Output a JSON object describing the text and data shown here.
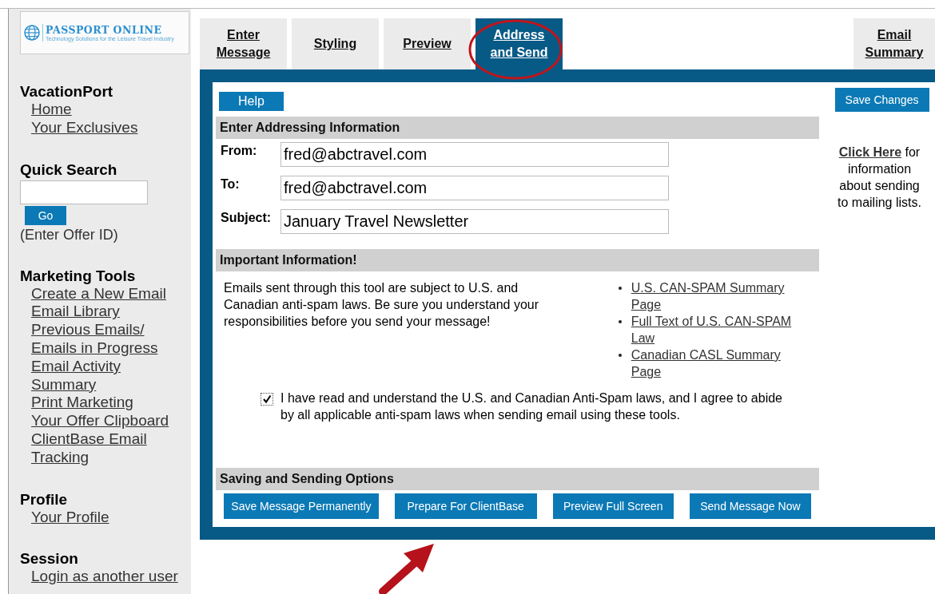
{
  "logo": {
    "name": "PASSPORT ONLINE",
    "tagline": "Technology Solutions for the Leisure Travel Industry"
  },
  "sidebar": {
    "sections": [
      {
        "title": "VacationPort",
        "items": [
          "Home",
          "Your Exclusives"
        ]
      },
      {
        "title": "Quick Search",
        "search": {
          "button": "Go",
          "hint": "(Enter Offer ID)"
        }
      },
      {
        "title": "Marketing Tools",
        "items": [
          "Create a New Email",
          "Email Library",
          "Previous Emails/ Emails in Progress",
          "Email Activity Summary",
          "Print Marketing",
          "Your Offer Clipboard",
          "ClientBase Email Tracking"
        ]
      },
      {
        "title": "Profile",
        "items": [
          "Your Profile"
        ]
      },
      {
        "title": "Session",
        "items": [
          "Login as another user"
        ]
      }
    ]
  },
  "tabs": [
    {
      "label": "Enter Message",
      "selected": false
    },
    {
      "label": "Styling",
      "selected": false
    },
    {
      "label": "Preview",
      "selected": false
    },
    {
      "label": "Address and Send",
      "selected": true
    },
    {
      "label": "Email Summary",
      "selected": false
    }
  ],
  "help_button": "Help",
  "save_button": "Save Changes",
  "note": {
    "link": "Click Here",
    "text": "for information about sending to mailing lists."
  },
  "addressing": {
    "title": "Enter Addressing Information",
    "fields": [
      {
        "label": "From:",
        "value": "fred@abctravel.com"
      },
      {
        "label": "To:",
        "value": "fred@abctravel.com"
      },
      {
        "label": "Subject:",
        "value": "January Travel Newsletter"
      }
    ]
  },
  "important": {
    "title": "Important Information!",
    "text": "Emails sent through this tool are subject to U.S. and Canadian anti-spam laws. Be sure you understand your responsibilities before you send your message!",
    "links": [
      "U.S. CAN-SPAM Summary Page",
      "Full Text of U.S. CAN-SPAM Law",
      "Canadian CASL Summary Page"
    ],
    "agreement": {
      "checked": true,
      "text": "I have read and understand the U.S. and Canadian Anti-Spam laws, and I agree to abide by all applicable anti-spam laws when sending email using these tools."
    }
  },
  "options": {
    "title": "Saving and Sending Options",
    "buttons": [
      "Save Message Permanently",
      "Prepare For ClientBase",
      "Preview Full Screen",
      "Send Message Now"
    ]
  }
}
